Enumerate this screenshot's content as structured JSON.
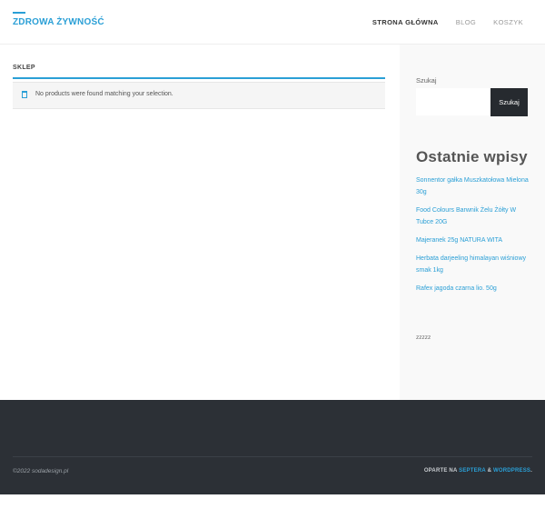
{
  "site": {
    "brand": "ZDROWA ŻYWNOŚĆ"
  },
  "nav": {
    "items": [
      {
        "label": "STRONA GŁÓWNA",
        "active": true
      },
      {
        "label": "BLOG",
        "active": false
      },
      {
        "label": "KOSZYK",
        "active": false
      }
    ]
  },
  "main": {
    "section_title": "SKLEP",
    "notice": "No products were found matching your selection."
  },
  "sidebar": {
    "search_label": "Szukaj",
    "search_value": "",
    "search_button": "Szukaj",
    "recent_title": "Ostatnie wpisy",
    "recent_posts": [
      "Sonnentor gałka Muszkatołowa Mielona 30g",
      "Food Colours Barwnik Żelu Żółty W Tubce 20G",
      "Majeranek 25g NATURA WITA",
      "Herbata darjeeling himalayan wiśniowy smak 1kg",
      "Rafex jagoda czarna lio. 50g"
    ],
    "misc_text": "zzzzz"
  },
  "footer": {
    "copyright": "©2022 sodadesign.pl",
    "powered_prefix": "OPARTE NA",
    "powered_link1": "SEPTERA",
    "powered_amp": "&",
    "powered_link2": "WORDPRESS",
    "powered_suffix": "."
  },
  "colors": {
    "accent": "#2a9fd6",
    "footer_bg": "#2c3036",
    "button_bg": "#262a2f"
  }
}
